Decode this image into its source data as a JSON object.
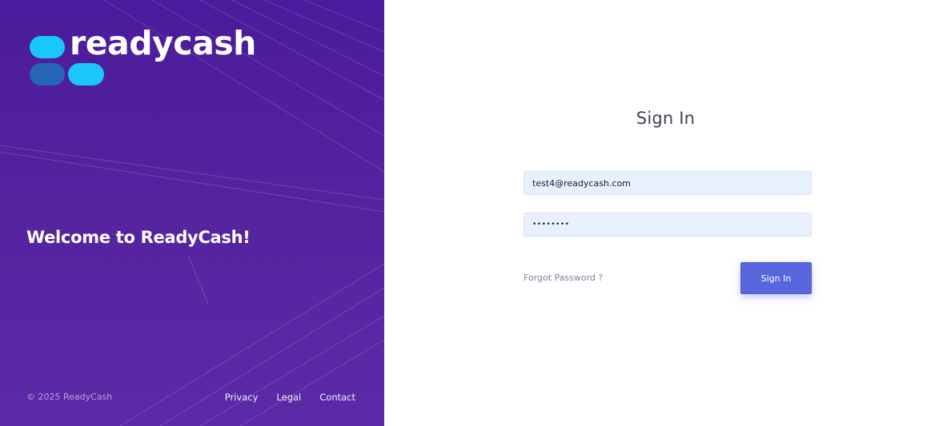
{
  "brand": {
    "logo_text": "readycash",
    "welcome": "Welcome to ReadyCash!",
    "colors": {
      "panel": "#4f1fa0",
      "logo_cyan": "#19c8f8",
      "logo_blue": "#2566b7",
      "accent": "#5767de"
    }
  },
  "footer": {
    "copyright": "© 2025 ReadyCash",
    "links": [
      "Privacy",
      "Legal",
      "Contact"
    ]
  },
  "form": {
    "title": "Sign In",
    "email_value": "test4@readycash.com",
    "password_value": "••••••••",
    "forgot_label": "Forgot Password ?",
    "submit_label": "Sign In"
  }
}
